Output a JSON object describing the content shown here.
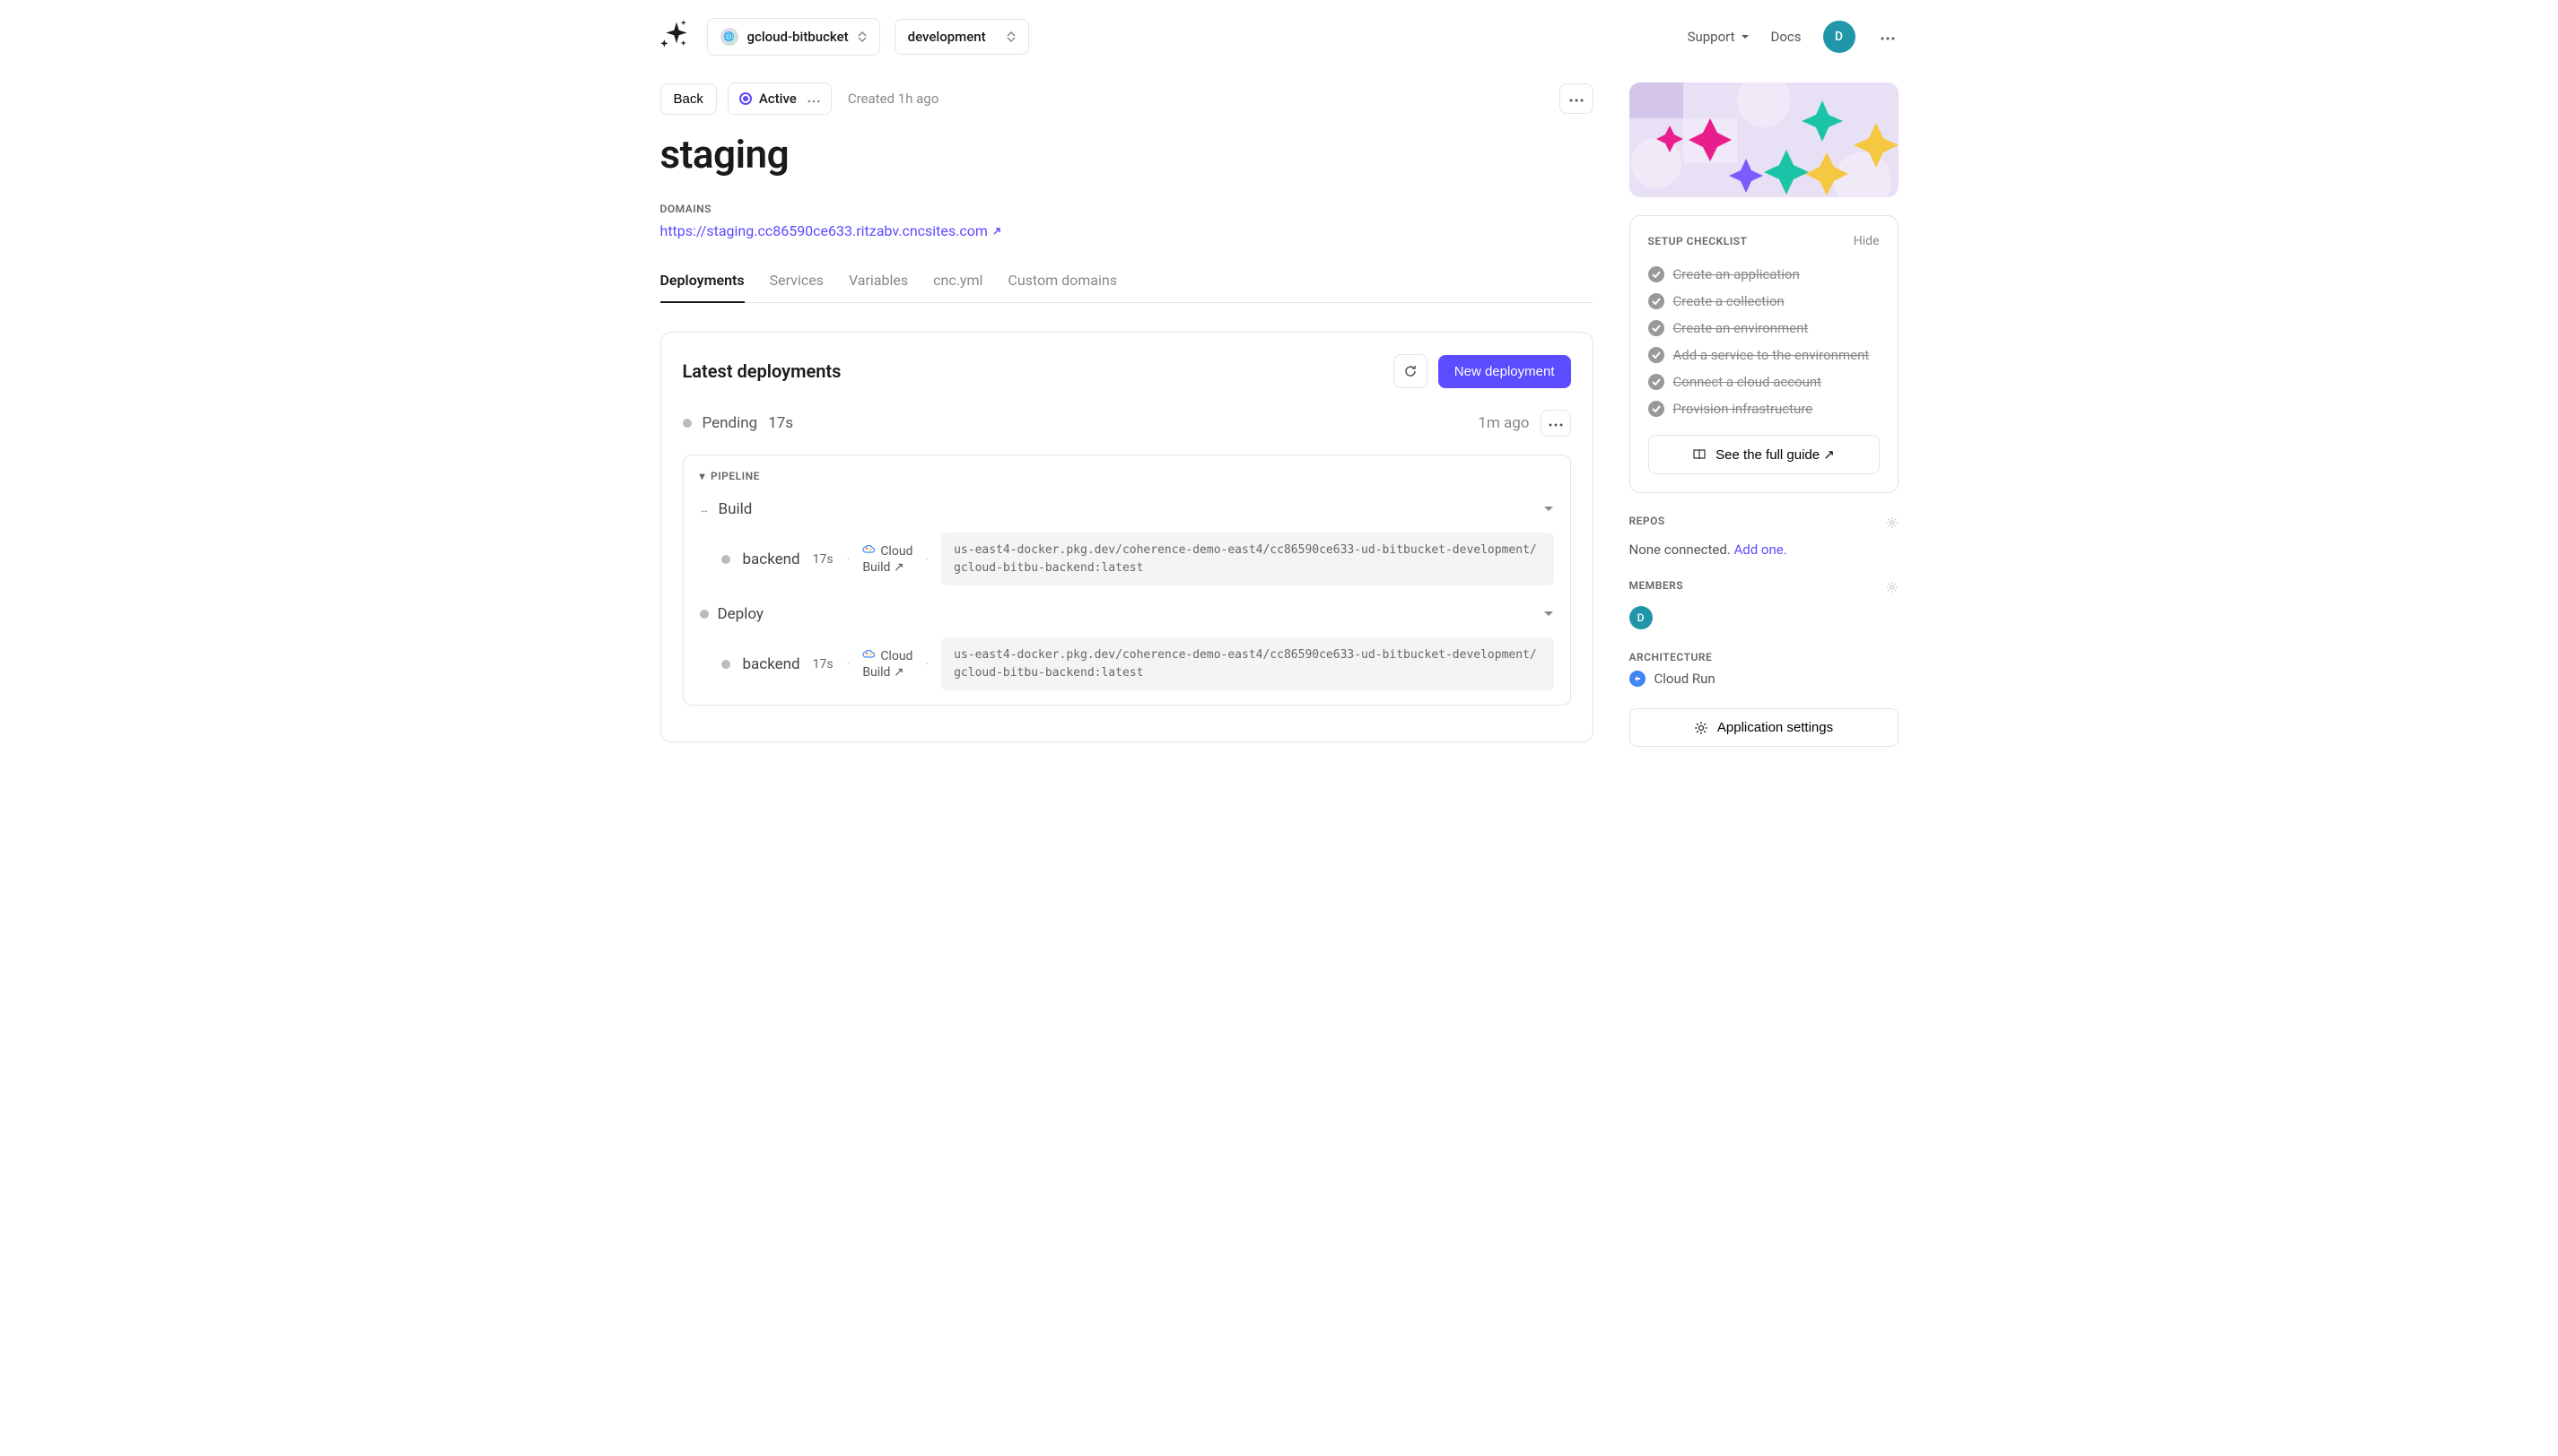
{
  "header": {
    "project": "gcloud-bitbucket",
    "environment": "development",
    "support": "Support",
    "docs": "Docs",
    "avatar_initial": "D"
  },
  "status": {
    "back": "Back",
    "badge": "Active",
    "created": "Created 1h ago"
  },
  "page_title": "staging",
  "domains": {
    "label": "DOMAINS",
    "url": "https://staging.cc86590ce633.ritzabv.cncsites.com"
  },
  "tabs": [
    "Deployments",
    "Services",
    "Variables",
    "cnc.yml",
    "Custom domains"
  ],
  "deployments": {
    "title": "Latest deployments",
    "new_button": "New deployment",
    "item": {
      "status": "Pending",
      "duration": "17s",
      "time": "1m ago",
      "pipeline_label": "PIPELINE",
      "stages": [
        {
          "name": "Build",
          "step_name": "backend",
          "step_duration": "17s",
          "provider": "Cloud",
          "provider2": "Build ↗",
          "image": "us-east4-docker.pkg.dev/coherence-demo-east4/cc86590ce633-ud-bitbucket-development/gcloud-bitbu-backend:latest"
        },
        {
          "name": "Deploy",
          "step_name": "backend",
          "step_duration": "17s",
          "provider": "Cloud",
          "provider2": "Build ↗",
          "image": "us-east4-docker.pkg.dev/coherence-demo-east4/cc86590ce633-ud-bitbucket-development/gcloud-bitbu-backend:latest"
        }
      ]
    }
  },
  "checklist": {
    "title": "SETUP CHECKLIST",
    "hide": "Hide",
    "items": [
      "Create an application",
      "Create a collection",
      "Create an environment",
      "Add a service to the environment",
      "Connect a cloud account",
      "Provision infrastructure"
    ],
    "guide": "See the full guide ↗"
  },
  "repos": {
    "label": "REPOS",
    "text": "None connected. ",
    "add": "Add one."
  },
  "members": {
    "label": "MEMBERS",
    "initial": "D"
  },
  "architecture": {
    "label": "ARCHITECTURE",
    "name": "Cloud Run"
  },
  "settings_button": "Application settings"
}
